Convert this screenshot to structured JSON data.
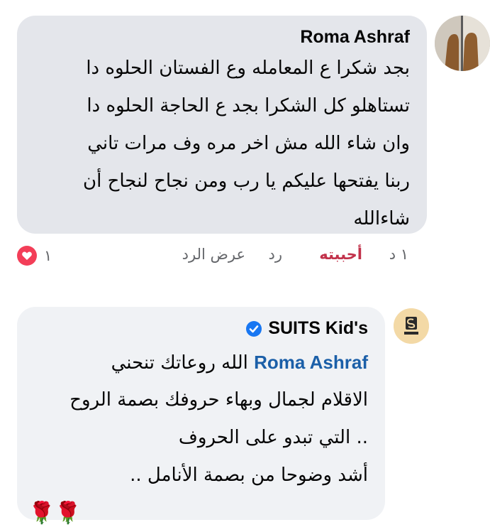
{
  "comment1": {
    "author": "Roma Ashraf",
    "lines": [
      "بجد شكرا ع المعامله وع الفستان الحلوه دا",
      "تستاهلو كل الشكرا بجد ع الحاجة الحلوه دا",
      "وان شاء الله مش اخر مره وف مرات تاني",
      "ربنا يفتحها عليكم يا رب ومن نجاح لنجاح أن",
      "شاءالله"
    ],
    "actions": {
      "time": "١ د",
      "like": "أحببته",
      "reply": "رد",
      "view_replies": "عرض الرد"
    },
    "reaction_count": "١"
  },
  "reply": {
    "author": "SUITS Kid's",
    "mention": "Roma Ashraf",
    "line1_text": "الله روعاتك تنحني",
    "lines": [
      "الاقلام لجمال وبهاء حروفك بصمة الروح",
      "..  التي تبدو على الحروف",
      "أشد وضوحا  من بصمة الأنامل .."
    ],
    "emojis": "🌹🌹"
  },
  "colors": {
    "bubble1": "#e4e6eb",
    "bubble2": "#f0f2f5",
    "mention": "#1b5fa8",
    "like": "#c2324b",
    "heart": "#f33e58",
    "verified": "#1877f2"
  }
}
